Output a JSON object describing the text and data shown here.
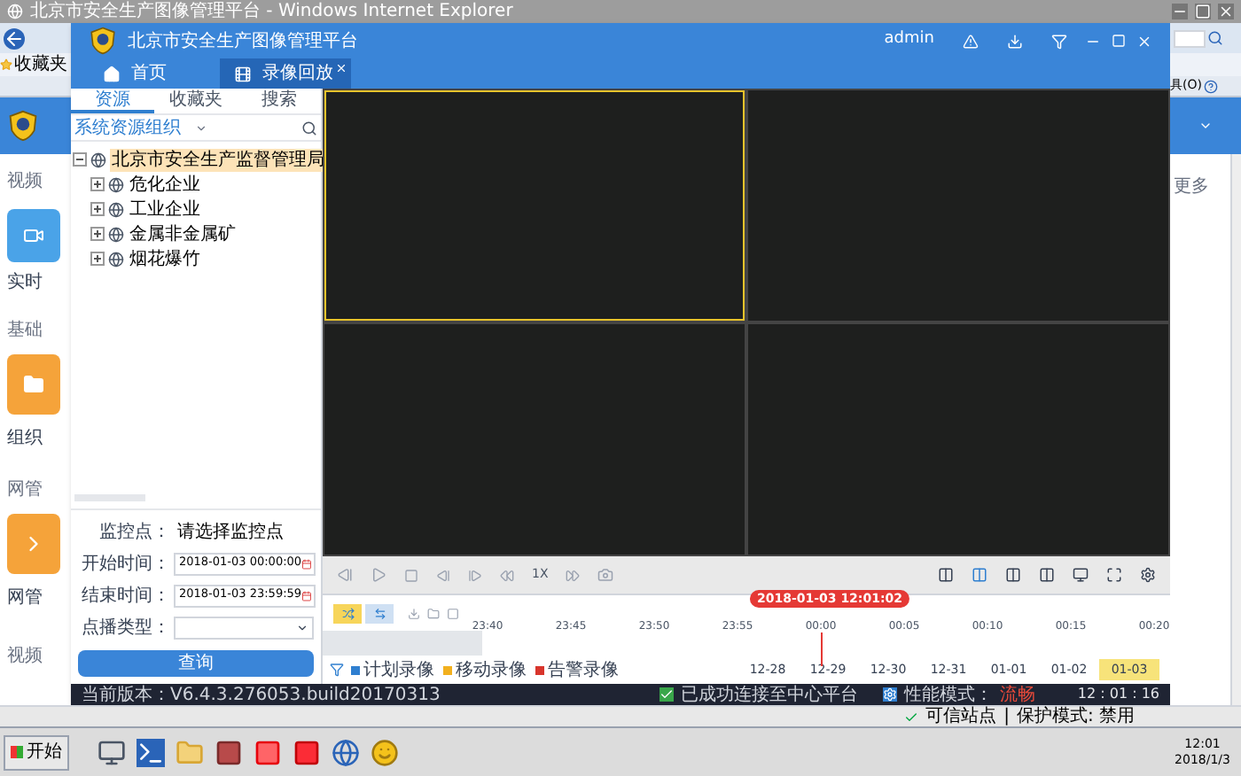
{
  "browser": {
    "title": "北京市安全生产图像管理平台 - Windows Internet Explorer",
    "favorites": "收藏夹",
    "menu_fragment": "具(O)",
    "page_labels": [
      "视频",
      "实时",
      "基础",
      "组织",
      "网管",
      "网管",
      "视频"
    ],
    "page_link": "更多",
    "zone": "可信站点",
    "separator": "|",
    "protected_mode": "保护模式: 禁用"
  },
  "app": {
    "title": "北京市安全生产图像管理平台",
    "user": "admin"
  },
  "tabs": [
    {
      "label": "首页",
      "selected": false,
      "closable": false
    },
    {
      "label": "录像回放",
      "selected": true,
      "closable": true
    }
  ],
  "panel_tabs": [
    {
      "label": "资源",
      "selected": true
    },
    {
      "label": "收藏夹",
      "selected": false
    },
    {
      "label": "搜索",
      "selected": false
    }
  ],
  "org_select": "系统资源组织",
  "tree": [
    {
      "label": "北京市安全生产监督管理局",
      "expanded": true,
      "selected": true,
      "children": [
        {
          "label": "危化企业",
          "expanded": false,
          "selected": false
        },
        {
          "label": "工业企业",
          "expanded": false,
          "selected": false
        },
        {
          "label": "金属非金属矿",
          "expanded": false,
          "selected": false
        },
        {
          "label": "烟花爆竹",
          "expanded": false,
          "selected": false
        }
      ]
    }
  ],
  "form": [
    {
      "kind": "text",
      "label": "监控点：",
      "value": "请选择监控点"
    },
    {
      "kind": "datetime",
      "label": "开始时间：",
      "value": "2018-01-03 00:00:00"
    },
    {
      "kind": "datetime",
      "label": "结束时间：",
      "value": "2018-01-03 23:59:59"
    },
    {
      "kind": "select",
      "label": "点播类型："
    }
  ],
  "query_button": "查询",
  "video_cells": [
    {
      "selected": true
    },
    {
      "selected": false
    },
    {
      "selected": false
    },
    {
      "selected": false
    }
  ],
  "speed": "1X",
  "layouts": [
    {
      "selected": false
    },
    {
      "selected": true
    },
    {
      "selected": false
    },
    {
      "selected": false
    }
  ],
  "time_badge": "2018-01-03 12:01:02",
  "modes": [
    {
      "selected": true
    },
    {
      "selected": false
    }
  ],
  "ticks": [
    "23:40",
    "23:45",
    "23:50",
    "23:55",
    "00:00",
    "00:05",
    "00:10",
    "00:15",
    "00:20"
  ],
  "legend": [
    {
      "label": "计划录像",
      "color": "#2f7fd0"
    },
    {
      "label": "移动录像",
      "color": "#f2b01e"
    },
    {
      "label": "告警录像",
      "color": "#d8352c"
    }
  ],
  "dates": [
    {
      "label": "12-28",
      "selected": false
    },
    {
      "label": "12-29",
      "selected": false
    },
    {
      "label": "12-30",
      "selected": false
    },
    {
      "label": "12-31",
      "selected": false
    },
    {
      "label": "01-01",
      "selected": false
    },
    {
      "label": "01-02",
      "selected": false
    },
    {
      "label": "01-03",
      "selected": true
    }
  ],
  "status_bar": {
    "version": "当前版本：V6.4.3.276053.build20170313",
    "connection": "已成功连接至中心平台",
    "perf_label": "性能模式：",
    "perf_value": "流畅",
    "clock": "12 : 01 : 16"
  },
  "taskbar": {
    "start": "开始",
    "time": "12:01",
    "date": "2018/1/3"
  }
}
